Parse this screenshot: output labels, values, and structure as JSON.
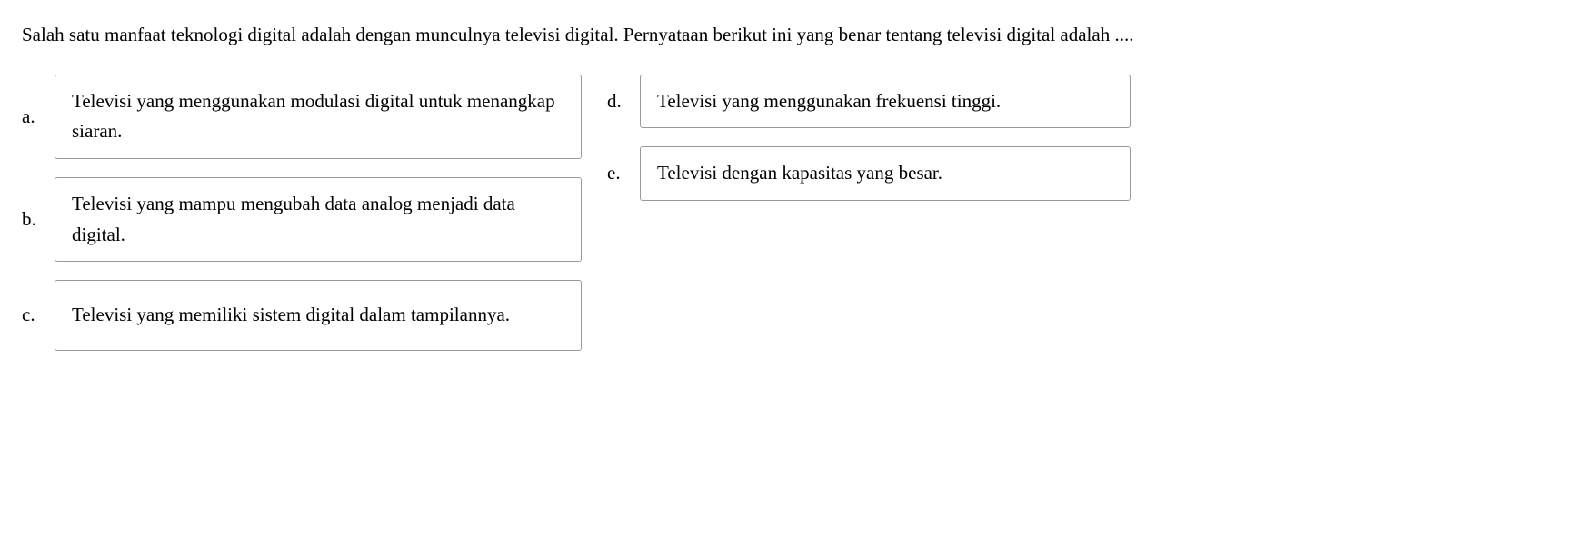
{
  "question": "Salah satu manfaat teknologi digital adalah dengan   munculnya televisi digital. Pernyataan berikut ini yang benar tentang televisi digital adalah ....",
  "options": {
    "a": {
      "letter": "a.",
      "text": "Televisi yang menggunakan modulasi digital untuk menangkap siaran."
    },
    "b": {
      "letter": "b.",
      "text": "Televisi yang mampu mengubah data analog menjadi data digital."
    },
    "c": {
      "letter": "c.",
      "text": "Televisi yang memiliki sistem digital dalam tampilannya."
    },
    "d": {
      "letter": "d.",
      "text": "Televisi yang menggunakan frekuensi tinggi."
    },
    "e": {
      "letter": "e.",
      "text": "Televisi dengan kapasitas yang besar."
    }
  }
}
